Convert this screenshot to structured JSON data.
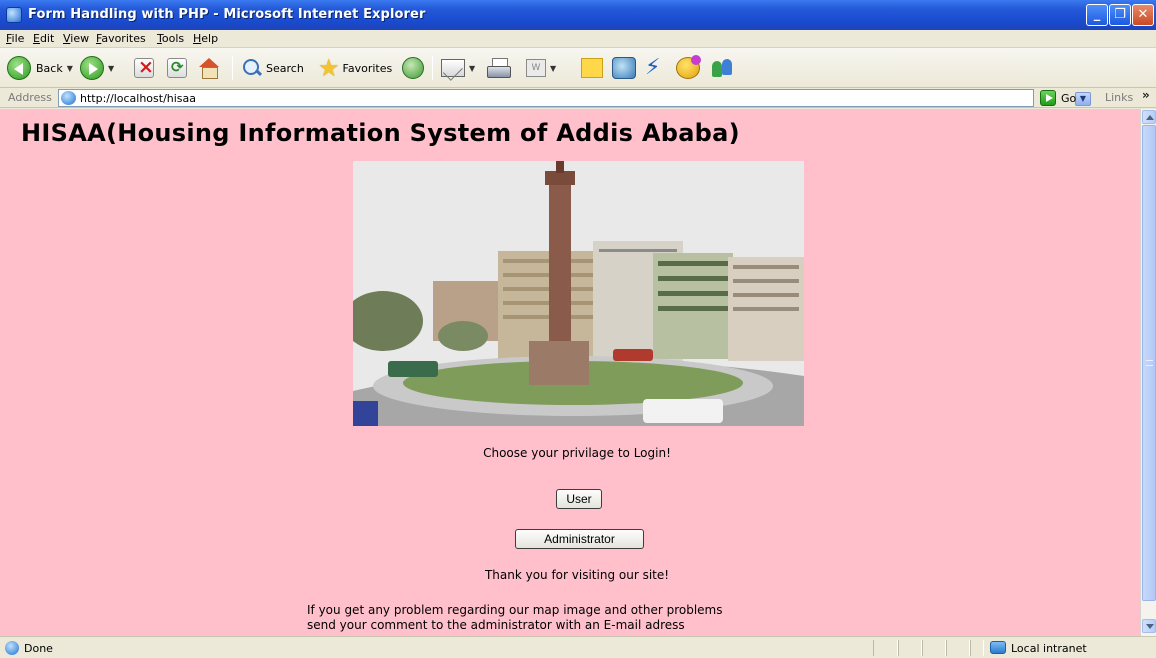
{
  "window": {
    "title": "Form Handling with PHP - Microsoft Internet Explorer",
    "minimize_symbol": "_",
    "maximize_symbol": "❐",
    "close_symbol": "✕"
  },
  "menu": [
    "File",
    "Edit",
    "View",
    "Favorites",
    "Tools",
    "Help"
  ],
  "toolbar": {
    "back_label": "Back",
    "search_label": "Search",
    "favorites_label": "Favorites",
    "word_label": "W"
  },
  "address": {
    "label": "Address",
    "url": "http://localhost/hisaa",
    "go_label": "Go",
    "links_label": "Links",
    "links_chevron": "»"
  },
  "page": {
    "heading": "HISAA(Housing Information System of Addis Ababa)",
    "choose_text": "Choose your privilage to Login!",
    "user_button": "User",
    "admin_button": "Administrator",
    "thanks_text": "Thank you for visiting our site!",
    "footer_line1": "If you get any problem regarding our map image and other problems",
    "footer_line2": "send your comment to the administrator with an E-mail adress"
  },
  "status": {
    "text": "Done",
    "zone": "Local intranet"
  },
  "colors": {
    "page_background": "#ffc0cb",
    "titlebar": "#1d4fd0",
    "chrome": "#ece9d8"
  },
  "icons": [
    "ie-logo-icon",
    "back-arrow-icon",
    "forward-arrow-icon",
    "stop-icon",
    "refresh-icon",
    "home-icon",
    "search-icon",
    "favorites-star-icon",
    "history-icon",
    "mail-icon",
    "print-icon",
    "edit-word-icon",
    "discuss-note-icon",
    "messenger-icon",
    "research-icon",
    "smiley-icon",
    "contacts-icon",
    "windows-logo-icon",
    "go-arrow-icon",
    "local-intranet-icon"
  ]
}
